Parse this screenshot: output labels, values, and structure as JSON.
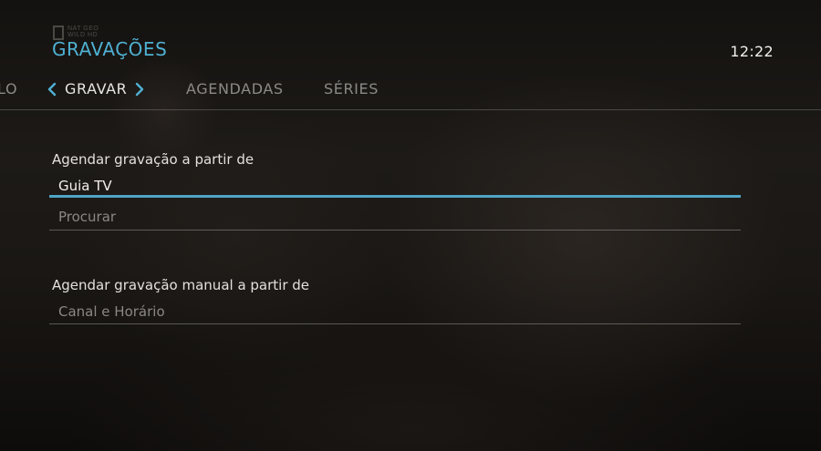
{
  "header": {
    "title": "GRAVAÇÕES",
    "clock": "12:22",
    "watermark": {
      "line1": "NAT GEO",
      "line2": "WILD HD"
    }
  },
  "tabs": {
    "previous_label": "LO",
    "current_label": "GRAVAR",
    "next_labels": [
      "AGENDADAS",
      "SÉRIES"
    ]
  },
  "sections": [
    {
      "heading": "Agendar gravação a partir de",
      "items": [
        {
          "label": "Guia TV",
          "focused": true
        },
        {
          "label": "Procurar",
          "focused": false
        }
      ]
    },
    {
      "heading": "Agendar gravação manual a partir de",
      "items": [
        {
          "label": "Canal e Horário",
          "focused": false
        }
      ]
    }
  ],
  "colors": {
    "accent": "#4fb0d2",
    "focus_line": "#4fa4c6",
    "text_primary": "#e4e1dd",
    "text_dim": "#8a8886"
  },
  "icons": {
    "tab_left": "chevron-left-icon",
    "tab_right": "chevron-right-icon"
  }
}
